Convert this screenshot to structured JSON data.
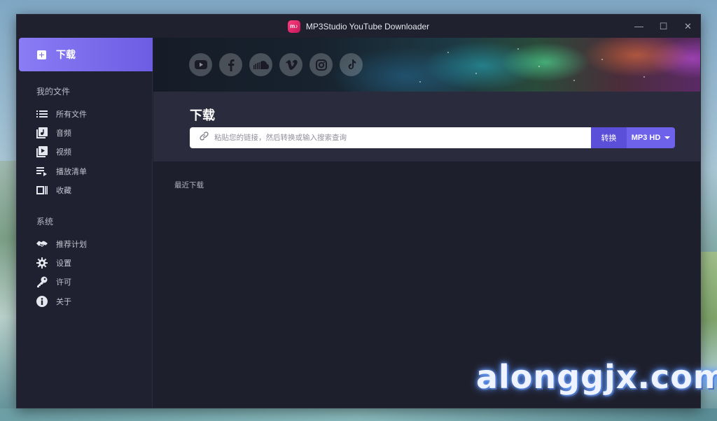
{
  "window": {
    "app_logo_text": "m♪",
    "title": "MP3Studio YouTube Downloader",
    "controls": {
      "minimize": "—",
      "maximize": "☐",
      "close": "✕"
    }
  },
  "sidebar": {
    "download_label": "下载",
    "my_files_title": "我的文件",
    "files": [
      {
        "label": "所有文件",
        "icon": "list-icon"
      },
      {
        "label": "音频",
        "icon": "music-file-icon"
      },
      {
        "label": "视频",
        "icon": "video-file-icon"
      },
      {
        "label": "播放清单",
        "icon": "playlist-icon"
      },
      {
        "label": "收藏",
        "icon": "collection-icon"
      }
    ],
    "system_title": "系统",
    "system": [
      {
        "label": "推荐计划",
        "icon": "handshake-icon"
      },
      {
        "label": "设置",
        "icon": "gear-icon"
      },
      {
        "label": "许可",
        "icon": "key-icon"
      },
      {
        "label": "关于",
        "icon": "info-icon"
      }
    ]
  },
  "banner": {
    "social": [
      "youtube-icon",
      "facebook-icon",
      "soundcloud-icon",
      "vimeo-icon",
      "instagram-icon",
      "tiktok-icon"
    ]
  },
  "download": {
    "title": "下载",
    "url_placeholder": "粘贴您的链接，然后转换或输入搜索查询",
    "url_value": "",
    "convert_label": "转换",
    "format_label": "MP3 HD"
  },
  "recent_label": "最近下载",
  "watermark": "alonggjx.com",
  "colors": {
    "accent": "#6e61ea",
    "accent_dark": "#5b4ed8",
    "sidebar_bg": "#202130",
    "main_bg": "#1e1f2c",
    "panel_bg": "#2a2b3c"
  }
}
